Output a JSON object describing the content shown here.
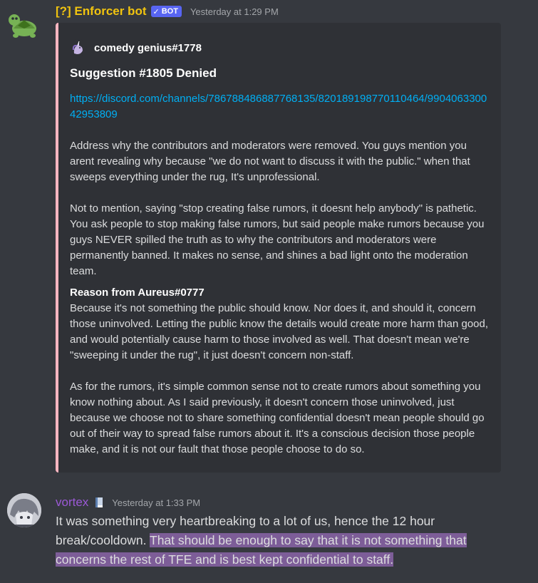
{
  "messages": [
    {
      "username": "[?] Enforcer bot",
      "bot_tag": "BOT",
      "bot_check": "✓",
      "timestamp": "Yesterday at 1:29 PM",
      "avatar_icon": "turtle-icon",
      "username_color": "#f1c40f",
      "embed": {
        "accent_color": "#ffb6c1",
        "author_name": "comedy genius#1778",
        "author_icon": "unicorn-icon",
        "title": "Suggestion #1805 Denied",
        "link": "https://discord.com/channels/786788486887768135/820189198770110464/990406330042953809",
        "paragraphs": [
          "Address why the contributors and moderators were removed. You guys mention you arent revealing why because \"we do not want to discuss it with the public.\" when that sweeps everything under the rug, It's unprofessional.",
          "Not to mention, saying \"stop creating false rumors, it doesnt help anybody\" is pathetic. You ask people to stop making false rumors, but said people make rumors because you guys NEVER spilled the truth as to why the contributors and moderators were permanently banned. It makes no sense, and shines a bad light onto the moderation team."
        ],
        "field": {
          "name": "Reason from Aureus#0777",
          "paragraphs": [
            "Because it's not something the public should know. Nor does it, and should it, concern those uninvolved. Letting the public know the details would create more harm than good, and would potentially cause harm to those involved as well. That doesn't mean we're \"sweeping it under the rug\", it just doesn't concern non-staff.",
            "As for the rumors, it's simple common sense not to create rumors about something you know nothing about. As I said previously, it doesn't concern those uninvolved, just because we choose not to share something confidential doesn't mean people should go out of their way to spread false rumors about it. It's a conscious decision those people make, and it is not our fault that those people choose to do so."
          ]
        }
      }
    },
    {
      "username": "vortex",
      "timestamp": "Yesterday at 1:33 PM",
      "avatar_icon": "anime-avatar-icon",
      "role_icon": "book-icon",
      "username_color": "#9b59d6",
      "text_plain": "It was something very heartbreaking to a lot of us, hence the 12 hour break/cooldown. ",
      "text_highlighted": "That should be enough to say that it is not something that concerns the rest of TFE and is best kept confidential to staff.",
      "highlight_color": "#7d5d98"
    }
  ]
}
